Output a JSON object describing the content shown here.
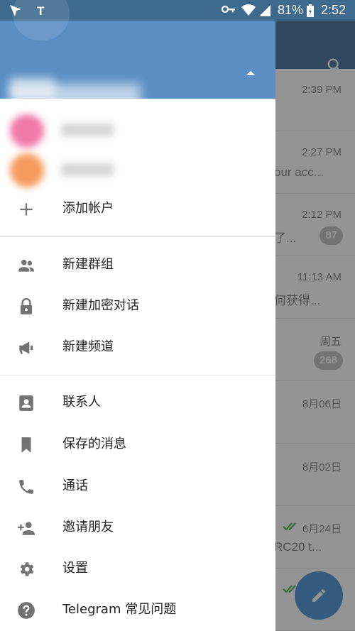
{
  "status_bar": {
    "notification_letter": "T",
    "battery_percent": "81%",
    "clock": "2:52",
    "icons": [
      "send-icon",
      "key-icon",
      "wifi-icon",
      "signal-icon",
      "battery-icon"
    ]
  },
  "background_chats": [
    {
      "time": "2:39 PM",
      "preview": "",
      "badge": ""
    },
    {
      "time": "2:27 PM",
      "preview": "our acc...",
      "badge": ""
    },
    {
      "time": "2:12 PM",
      "preview": "了...",
      "badge": "87"
    },
    {
      "time": "11:13 AM",
      "preview": "何获得...",
      "badge": ""
    },
    {
      "time": "周五",
      "preview": "",
      "badge": "268"
    },
    {
      "time": "8月06日",
      "preview": "",
      "badge": ""
    },
    {
      "time": "8月02日",
      "preview": "",
      "badge": ""
    },
    {
      "time": "6月24日",
      "preview": "RC20 t...",
      "badge": ""
    },
    {
      "time": "",
      "preview": "",
      "badge": ""
    }
  ],
  "drawer": {
    "add_account": "添加帐户",
    "menu_group_1": [
      {
        "label": "新建群组",
        "icon": "group-icon"
      },
      {
        "label": "新建加密对话",
        "icon": "lock-icon"
      },
      {
        "label": "新建频道",
        "icon": "megaphone-icon"
      }
    ],
    "menu_group_2": [
      {
        "label": "联系人",
        "icon": "contacts-icon"
      },
      {
        "label": "保存的消息",
        "icon": "bookmark-icon"
      },
      {
        "label": "通话",
        "icon": "phone-icon"
      },
      {
        "label": "邀请朋友",
        "icon": "invite-friend-icon"
      },
      {
        "label": "设置",
        "icon": "gear-icon"
      },
      {
        "label": "Telegram 常见问题",
        "icon": "help-icon"
      }
    ]
  },
  "colors": {
    "header_blue": "#5b8fc4",
    "status_bar": "#3e6a8e",
    "fab": "#5b9bd8",
    "icon_gray": "#737373",
    "read_check_green": "#4cb050"
  }
}
